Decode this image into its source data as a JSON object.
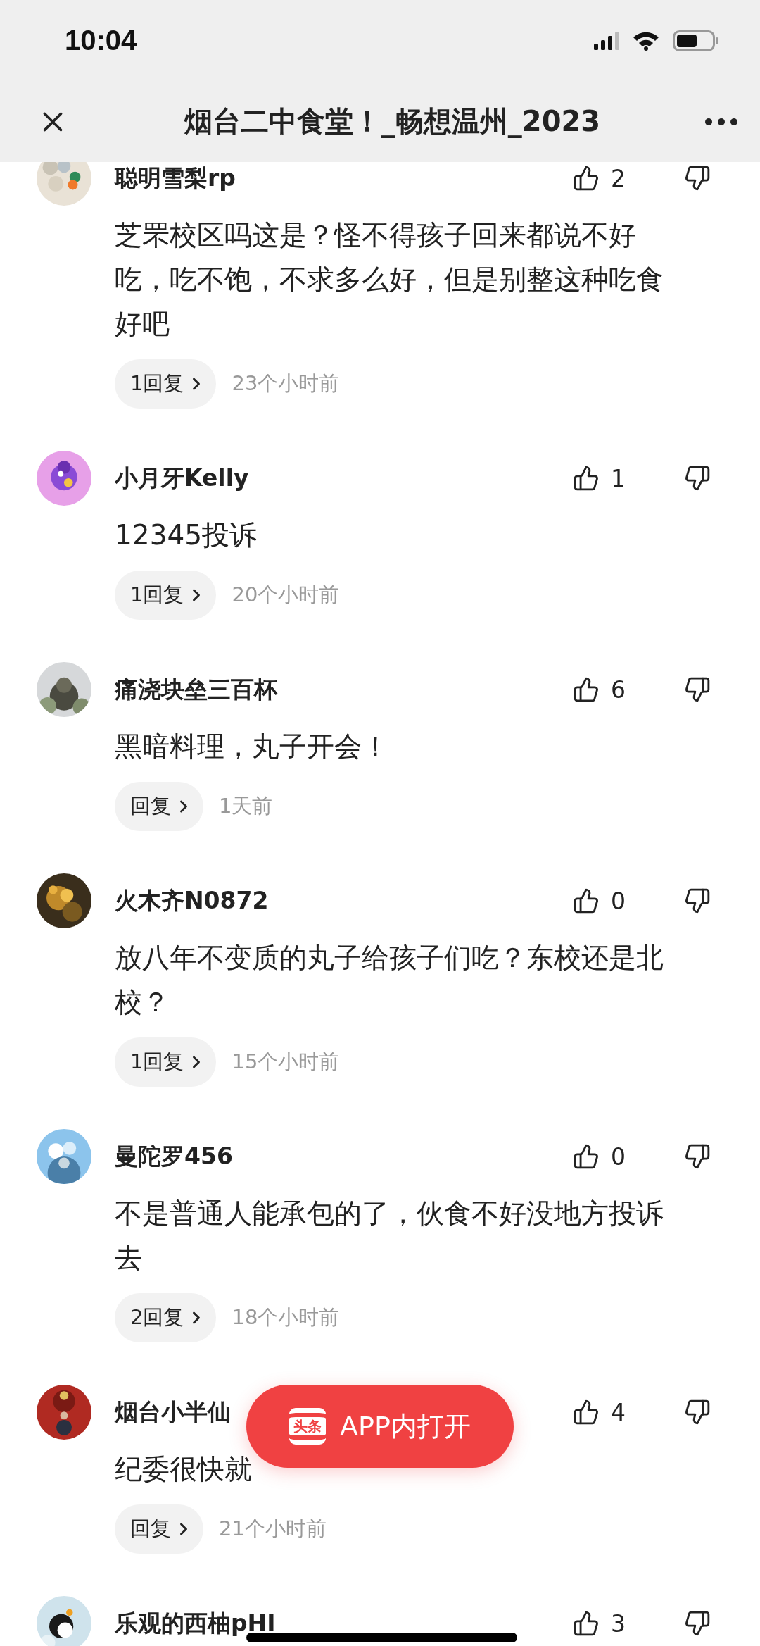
{
  "status_bar": {
    "time": "10:04"
  },
  "nav": {
    "title": "烟台二中食堂！_畅想温州_2023"
  },
  "comments": [
    {
      "name": "聪明雪梨rp",
      "likes": "2",
      "text": "芝罘校区吗这是？怪不得孩子回来都说不好吃，吃不饱，不求多么好，但是别整这种吃食好吧",
      "replies": "1回复",
      "time": "23个小时前"
    },
    {
      "name": "小月牙Kelly",
      "likes": "1",
      "text": "12345投诉",
      "replies": "1回复",
      "time": "20个小时前"
    },
    {
      "name": "痛浇块垒三百杯",
      "likes": "6",
      "text": "黑暗料理，丸子开会！",
      "replies": "回复",
      "time": "1天前"
    },
    {
      "name": "火木齐N0872",
      "likes": "0",
      "text": "放八年不变质的丸子给孩子们吃？东校还是北校？",
      "replies": "1回复",
      "time": "15个小时前"
    },
    {
      "name": "曼陀罗456",
      "likes": "0",
      "text": "不是普通人能承包的了，伙食不好没地方投诉去",
      "replies": "2回复",
      "time": "18个小时前"
    },
    {
      "name": "烟台小半仙",
      "likes": "4",
      "text": "纪委很快就",
      "replies": "回复",
      "time": "21个小时前"
    },
    {
      "name": "乐观的西柚pHI",
      "likes": "3"
    }
  ],
  "open_in_app": {
    "logo": "头条",
    "label": "APP内打开"
  }
}
